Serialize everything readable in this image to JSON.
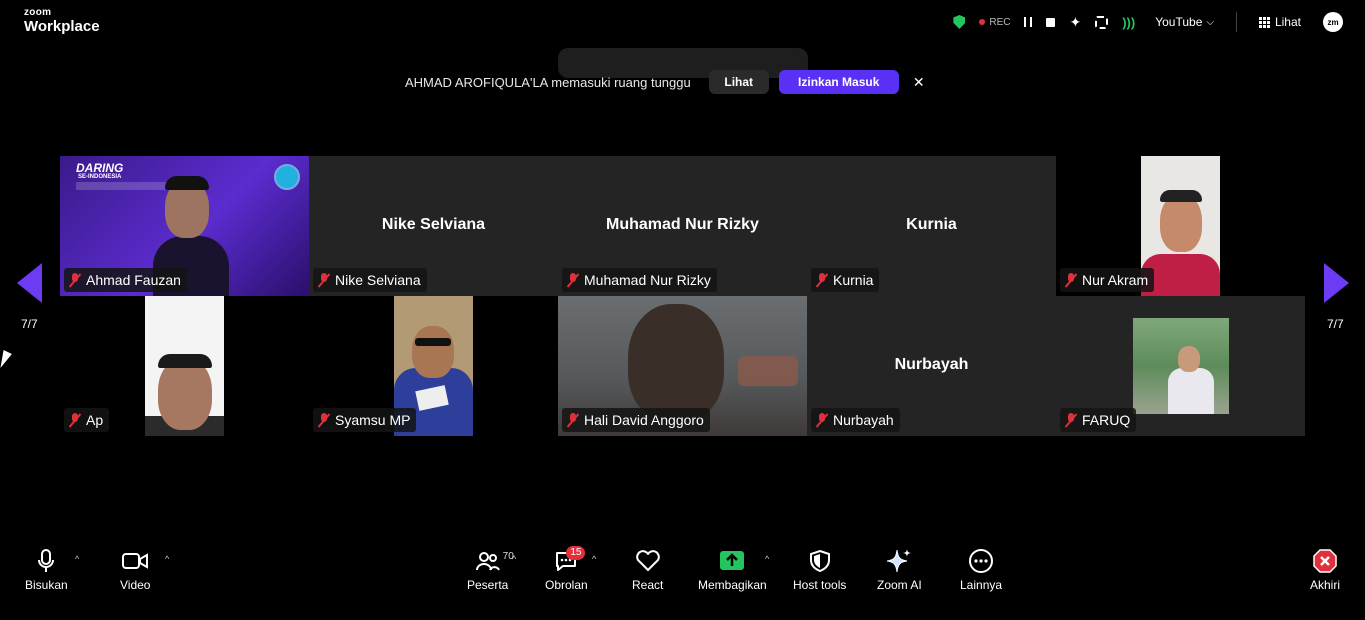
{
  "app": {
    "brand_small": "zoom",
    "brand_big": "Workplace"
  },
  "top_bar": {
    "rec_label": "REC",
    "live_target": "YouTube",
    "view_label": "Lihat",
    "avatar_initials": "zm",
    "icons": [
      "shield-check-icon",
      "pause-icon",
      "stop-icon",
      "sparkle-icon",
      "focus-icon",
      "live-stream-icon",
      "grid-icon"
    ]
  },
  "notification": {
    "text": "AHMAD AROFIQULA'LA memasuki ruang tunggu",
    "view_button": "Lihat",
    "admit_button": "Izinkan Masuk",
    "close": "✕"
  },
  "pagination": {
    "left_label": "7/7",
    "right_label": "7/7"
  },
  "participants": [
    {
      "name": "Ahmad Fauzan",
      "video": true,
      "muted": true,
      "center_name": ""
    },
    {
      "name": "Nike Selviana",
      "video": false,
      "muted": true,
      "center_name": "Nike Selviana"
    },
    {
      "name": "Muhamad Nur Rizky",
      "video": false,
      "muted": true,
      "center_name": "Muhamad Nur Rizky"
    },
    {
      "name": "Kurnia",
      "video": false,
      "muted": true,
      "center_name": "Kurnia"
    },
    {
      "name": "Nur Akram",
      "video": true,
      "muted": true,
      "center_name": ""
    },
    {
      "name": "Ap",
      "video": true,
      "muted": true,
      "center_name": ""
    },
    {
      "name": "Syamsu MP",
      "video": true,
      "muted": true,
      "center_name": ""
    },
    {
      "name": "Hali David Anggoro",
      "video": true,
      "muted": true,
      "center_name": ""
    },
    {
      "name": "Nurbayah",
      "video": false,
      "muted": true,
      "center_name": "Nurbayah"
    },
    {
      "name": "FARUQ",
      "video": true,
      "muted": true,
      "center_name": ""
    }
  ],
  "banner": {
    "title": "DARING",
    "subtitle": "SE-INDONESIA"
  },
  "toolbar": {
    "mute": "Bisukan",
    "video": "Video",
    "participants": "Peserta",
    "participants_count": "70",
    "chat": "Obrolan",
    "chat_badge": "15",
    "react": "React",
    "share": "Membagikan",
    "host_tools": "Host tools",
    "zoom_ai": "Zoom AI",
    "more": "Lainnya",
    "end": "Akhiri"
  },
  "colors": {
    "accent": "#5a31f4",
    "arrow": "#6c3cf5",
    "muted_red": "#e0303b",
    "share_green": "#22c55e",
    "tile_gray": "#242424"
  }
}
